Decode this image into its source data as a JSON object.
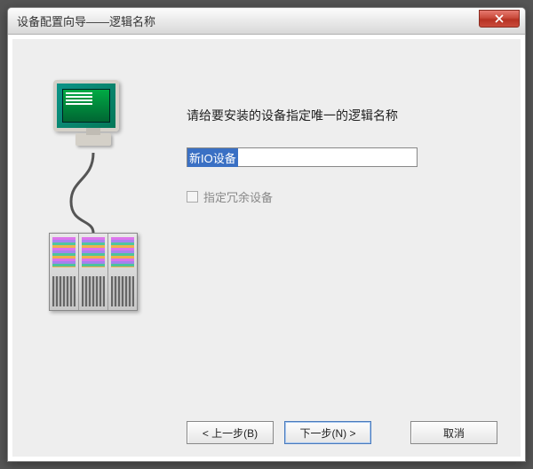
{
  "window": {
    "title": "设备配置向导——逻辑名称"
  },
  "form": {
    "instruction": "请给要安装的设备指定唯一的逻辑名称",
    "input_value": "新IO设备",
    "checkbox_label": "指定冗余设备"
  },
  "buttons": {
    "back": "< 上一步(B)",
    "next": "下一步(N) >",
    "cancel": "取消"
  }
}
